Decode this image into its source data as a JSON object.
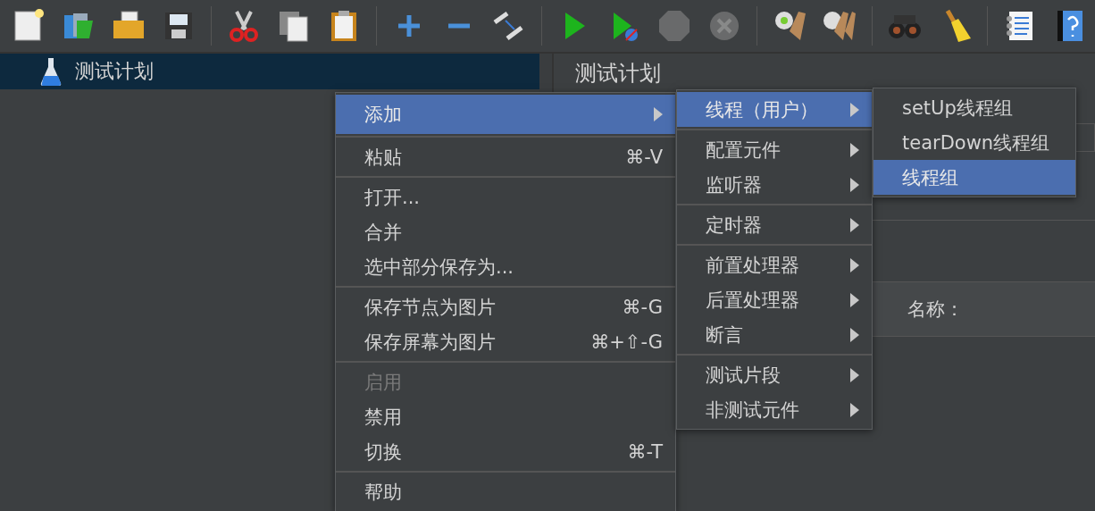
{
  "toolbar": {
    "buttons": [
      {
        "disabled": false
      },
      {
        "disabled": false
      },
      {
        "disabled": false
      },
      {
        "disabled": false
      },
      {
        "disabled": false
      },
      {
        "disabled": false
      },
      {
        "disabled": false
      },
      {
        "disabled": false
      },
      {
        "disabled": false
      },
      {
        "disabled": false
      },
      {
        "disabled": false
      },
      {
        "disabled": false
      },
      {
        "disabled": true
      },
      {
        "disabled": true
      },
      {
        "disabled": false
      },
      {
        "disabled": false
      },
      {
        "disabled": false
      },
      {
        "disabled": false
      },
      {
        "disabled": false
      },
      {
        "disabled": false
      }
    ]
  },
  "tree": {
    "items": [
      {
        "label": "测试计划",
        "selected": true
      }
    ]
  },
  "panel": {
    "title": "测试计划",
    "name_label": "名称："
  },
  "context_menu": {
    "items": [
      {
        "kind": "item",
        "label": "添加",
        "has_submenu": true,
        "selected": true,
        "disabled": false
      },
      {
        "kind": "separator"
      },
      {
        "kind": "item",
        "label": "粘贴",
        "shortcut": "⌘-V",
        "has_submenu": false,
        "selected": false,
        "disabled": false
      },
      {
        "kind": "separator"
      },
      {
        "kind": "item",
        "label": "打开...",
        "has_submenu": false,
        "selected": false,
        "disabled": false
      },
      {
        "kind": "item",
        "label": "合并",
        "has_submenu": false,
        "selected": false,
        "disabled": false
      },
      {
        "kind": "item",
        "label": "选中部分保存为...",
        "has_submenu": false,
        "selected": false,
        "disabled": false
      },
      {
        "kind": "separator"
      },
      {
        "kind": "item",
        "label": "保存节点为图片",
        "shortcut": "⌘-G",
        "has_submenu": false,
        "selected": false,
        "disabled": false
      },
      {
        "kind": "item",
        "label": "保存屏幕为图片",
        "shortcut": "⌘+⇧-G",
        "has_submenu": false,
        "selected": false,
        "disabled": false
      },
      {
        "kind": "separator"
      },
      {
        "kind": "item",
        "label": "启用",
        "has_submenu": false,
        "selected": false,
        "disabled": true
      },
      {
        "kind": "item",
        "label": "禁用",
        "has_submenu": false,
        "selected": false,
        "disabled": false
      },
      {
        "kind": "item",
        "label": "切换",
        "shortcut": "⌘-T",
        "has_submenu": false,
        "selected": false,
        "disabled": false
      },
      {
        "kind": "separator"
      },
      {
        "kind": "item",
        "label": "帮助",
        "has_submenu": false,
        "selected": false,
        "disabled": false
      }
    ]
  },
  "submenu": {
    "items": [
      {
        "kind": "item",
        "label": "线程（用户）",
        "has_submenu": true,
        "selected": true,
        "disabled": false
      },
      {
        "kind": "separator"
      },
      {
        "kind": "item",
        "label": "配置元件",
        "has_submenu": true,
        "selected": false,
        "disabled": false
      },
      {
        "kind": "item",
        "label": "监听器",
        "has_submenu": true,
        "selected": false,
        "disabled": false
      },
      {
        "kind": "separator"
      },
      {
        "kind": "item",
        "label": "定时器",
        "has_submenu": true,
        "selected": false,
        "disabled": false
      },
      {
        "kind": "separator"
      },
      {
        "kind": "item",
        "label": "前置处理器",
        "has_submenu": true,
        "selected": false,
        "disabled": false
      },
      {
        "kind": "item",
        "label": "后置处理器",
        "has_submenu": true,
        "selected": false,
        "disabled": false
      },
      {
        "kind": "item",
        "label": "断言",
        "has_submenu": true,
        "selected": false,
        "disabled": false
      },
      {
        "kind": "separator"
      },
      {
        "kind": "item",
        "label": "测试片段",
        "has_submenu": true,
        "selected": false,
        "disabled": false
      },
      {
        "kind": "item",
        "label": "非测试元件",
        "has_submenu": true,
        "selected": false,
        "disabled": false
      }
    ]
  },
  "submenu_2": {
    "items": [
      {
        "kind": "item",
        "label": "setUp线程组",
        "has_submenu": false,
        "selected": false,
        "disabled": false
      },
      {
        "kind": "item",
        "label": "tearDown线程组",
        "has_submenu": false,
        "selected": false,
        "disabled": false
      },
      {
        "kind": "item",
        "label": "线程组",
        "has_submenu": false,
        "selected": true,
        "disabled": false
      }
    ]
  }
}
